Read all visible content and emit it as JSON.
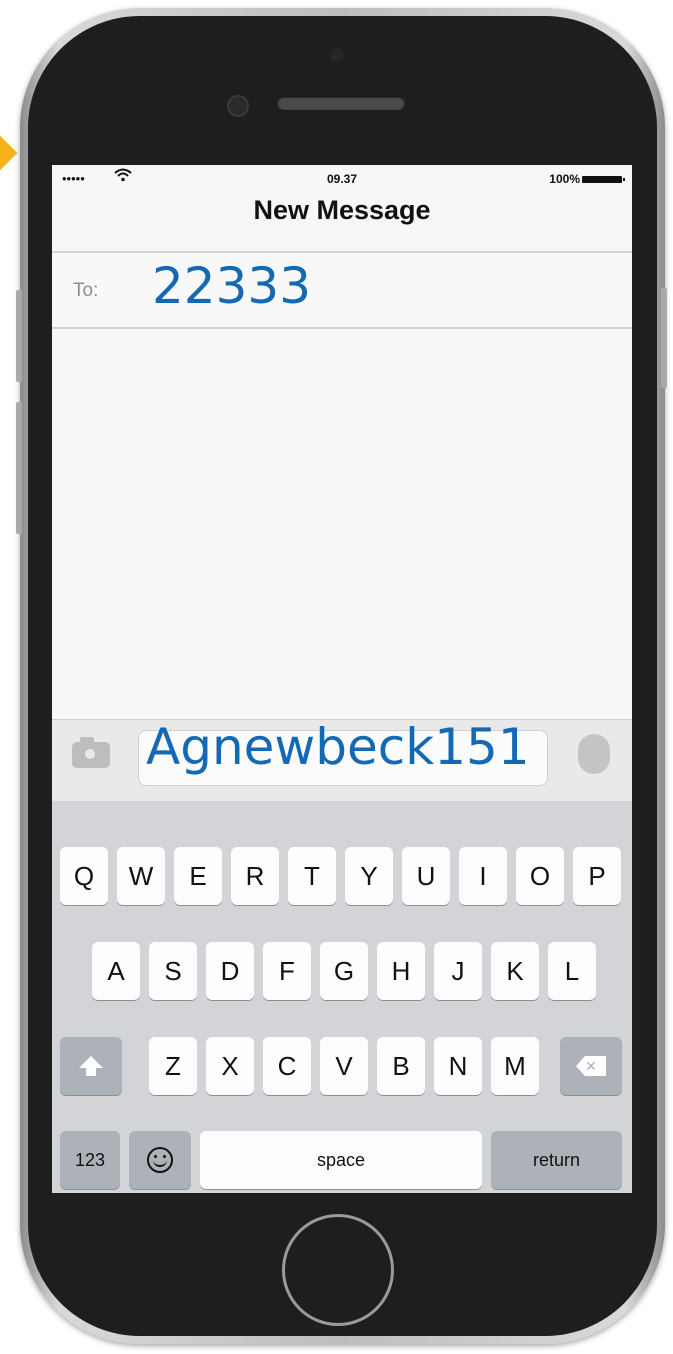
{
  "status_bar": {
    "signal": "•••••",
    "time": "09.37",
    "battery_pct": "100%"
  },
  "header": {
    "title": "New Message"
  },
  "recipient": {
    "label": "To:",
    "value": "22333"
  },
  "composer": {
    "text": "Agnewbeck151"
  },
  "keyboard": {
    "row1": [
      "Q",
      "W",
      "E",
      "R",
      "T",
      "Y",
      "U",
      "I",
      "O",
      "P"
    ],
    "row2": [
      "A",
      "S",
      "D",
      "F",
      "G",
      "H",
      "J",
      "K",
      "L"
    ],
    "row3": [
      "Z",
      "X",
      "C",
      "V",
      "B",
      "N",
      "M"
    ],
    "numbers_label": "123",
    "space_label": "space",
    "return_label": "return"
  },
  "icons": {
    "wifi": "wifi-icon",
    "battery": "battery-icon",
    "camera": "camera-icon",
    "mic": "mic-icon",
    "shift": "shift-icon",
    "backspace": "backspace-icon",
    "emoji": "emoji-icon"
  },
  "colors": {
    "accent_blue": "#1469b5",
    "keyboard_bg": "#d2d4d7",
    "key_bg": "#fdfdfd",
    "function_key_bg": "#adb2b8",
    "marker": "#f6b21a"
  }
}
